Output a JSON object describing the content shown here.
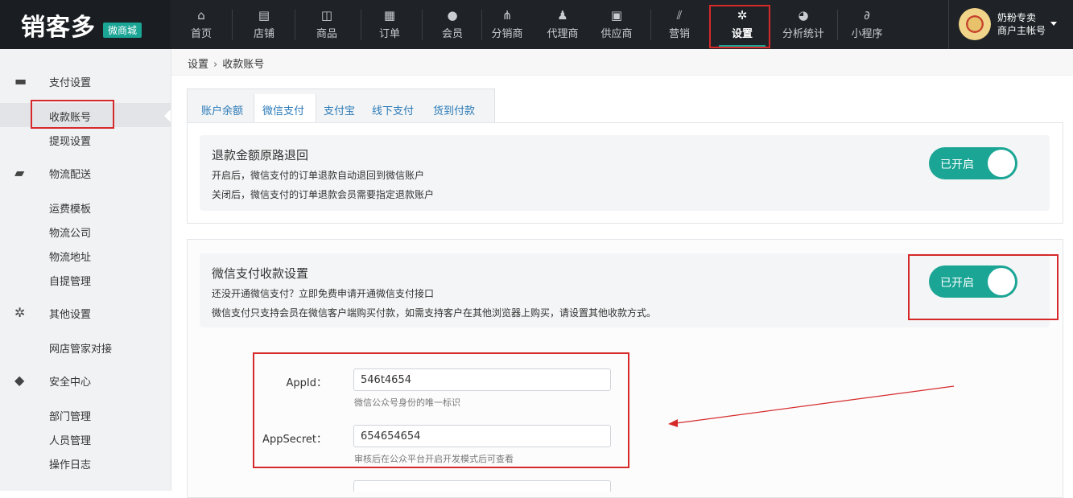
{
  "logo": {
    "main": "销客多",
    "badge": "微商城"
  },
  "nav": {
    "items": [
      {
        "label": "首页",
        "icon": "home-icon"
      },
      {
        "label": "店铺",
        "icon": "store-icon"
      },
      {
        "label": "商品",
        "icon": "bag-icon"
      },
      {
        "label": "订单",
        "icon": "clipboard-icon"
      },
      {
        "label": "会员",
        "icon": "user-icon"
      },
      {
        "label": "分销商",
        "icon": "org-icon"
      },
      {
        "label": "代理商",
        "icon": "agent-icon"
      },
      {
        "label": "供应商",
        "icon": "truck-icon"
      },
      {
        "label": "营销",
        "icon": "chart-icon"
      },
      {
        "label": "设置",
        "icon": "gear-icon"
      },
      {
        "label": "分析统计",
        "icon": "pie-icon"
      },
      {
        "label": "小程序",
        "icon": "link-icon"
      }
    ],
    "active": "设置"
  },
  "user": {
    "name": "奶粉专卖",
    "role": "商户主帐号"
  },
  "sidebar": {
    "groups": [
      {
        "label": "支付设置",
        "icon": "card-icon",
        "items": [
          "收款账号",
          "提现设置"
        ]
      },
      {
        "label": "物流配送",
        "icon": "truck-icon",
        "items": [
          "运费模板",
          "物流公司",
          "物流地址",
          "自提管理"
        ]
      },
      {
        "label": "其他设置",
        "icon": "gear-icon",
        "items": [
          "网店管家对接"
        ]
      },
      {
        "label": "安全中心",
        "icon": "shield-icon",
        "items": [
          "部门管理",
          "人员管理",
          "操作日志"
        ]
      }
    ],
    "active_item": "收款账号"
  },
  "breadcrumb": {
    "root": "设置",
    "sep": "›",
    "current": "收款账号"
  },
  "tabs": [
    "账户余额",
    "微信支付",
    "支付宝",
    "线下支付",
    "货到付款"
  ],
  "active_tab": "微信支付",
  "refund_setting": {
    "title": "退款金额原路退回",
    "desc1": "开启后，微信支付的订单退款自动退回到微信账户",
    "desc2": "关闭后，微信支付的订单退款会员需要指定退款账户",
    "toggle_label": "已开启",
    "enabled": true
  },
  "wechat_setting": {
    "title": "微信支付收款设置",
    "desc1": "还没开通微信支付？立即免费申请开通微信支付接口",
    "desc2": "微信支付只支持会员在微信客户端购买付款，如需支持客户在其他浏览器上购买，请设置其他收款方式。",
    "toggle_label": "已开启",
    "enabled": true
  },
  "form": {
    "appid_label": "AppId：",
    "appid_value": "546t4654",
    "appid_hint": "微信公众号身份的唯一标识",
    "appsecret_label": "AppSecret：",
    "appsecret_value": "654654654",
    "appsecret_hint": "审核后在公众平台开启开发模式后可查看"
  },
  "colors": {
    "accent": "#1aa595",
    "highlight": "#d62a2a",
    "nav_bg": "#1f2327"
  }
}
